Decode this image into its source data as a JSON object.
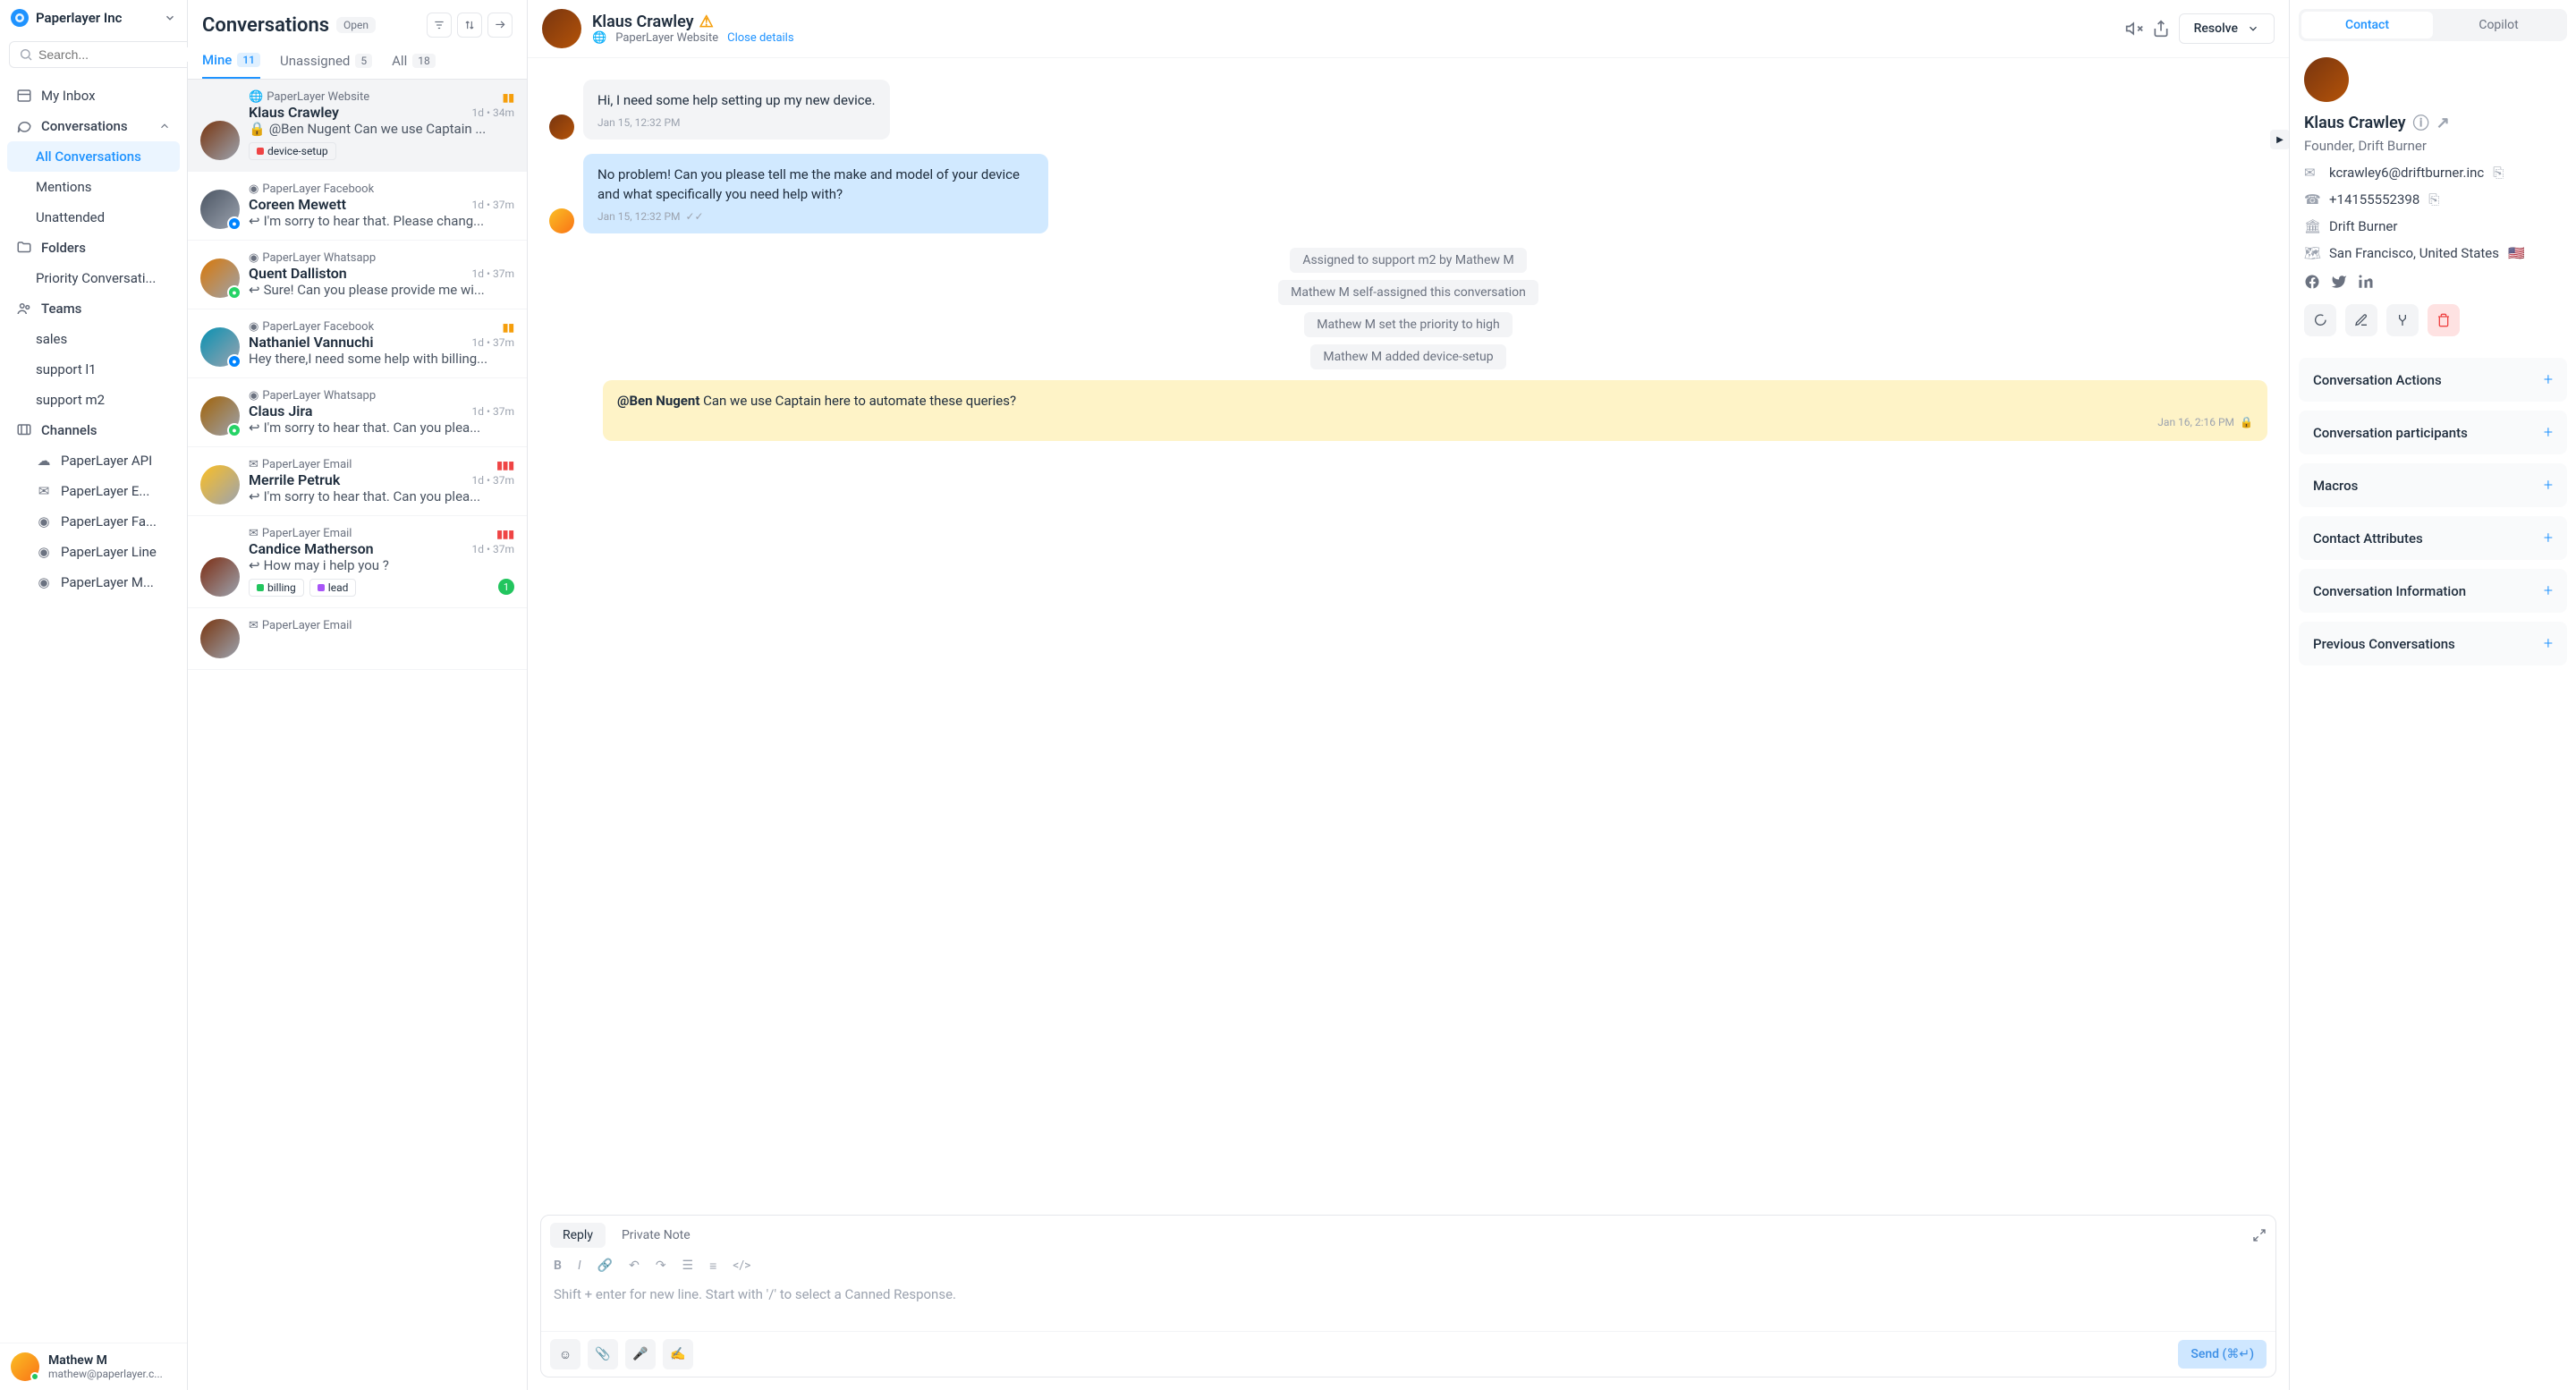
{
  "workspace": {
    "name": "Paperlayer Inc"
  },
  "search": {
    "placeholder": "Search..."
  },
  "nav": {
    "inbox": "My Inbox",
    "conversations": "Conversations",
    "all_conv": "All Conversations",
    "mentions": "Mentions",
    "unattended": "Unattended",
    "folders": "Folders",
    "priority": "Priority Conversati...",
    "teams": "Teams",
    "team1": "sales",
    "team2": "support l1",
    "team3": "support m2",
    "channels": "Channels",
    "ch": [
      "PaperLayer API",
      "PaperLayer E...",
      "PaperLayer Fa...",
      "PaperLayer Line",
      "PaperLayer M..."
    ]
  },
  "user": {
    "name": "Mathew M",
    "email": "mathew@paperlayer.c..."
  },
  "list": {
    "title": "Conversations",
    "status": "Open",
    "tabs": {
      "mine": "Mine",
      "mine_count": "11",
      "unassigned": "Unassigned",
      "un_count": "5",
      "all": "All",
      "all_count": "18"
    },
    "items": [
      {
        "channel": "PaperLayer Website",
        "name": "Klaus Crawley",
        "time": "1d • 34m",
        "preview": "@Ben Nugent Can we use Captain ...",
        "labels": [
          {
            "c": "#ef4444",
            "t": "device-setup"
          }
        ],
        "selected": true,
        "priority": true,
        "lock": true,
        "ch_ico": "globe"
      },
      {
        "channel": "PaperLayer Facebook",
        "name": "Coreen Mewett",
        "time": "1d • 37m",
        "preview": "I'm sorry to hear that. Please chang...",
        "reply": true,
        "ch_badge": "#0084ff"
      },
      {
        "channel": "PaperLayer Whatsapp",
        "name": "Quent Dalliston",
        "time": "1d • 37m",
        "preview": "Sure! Can you please provide me wi...",
        "reply": true,
        "ch_badge": "#25d366"
      },
      {
        "channel": "PaperLayer Facebook",
        "name": "Nathaniel Vannuchi",
        "time": "1d • 37m",
        "preview": "Hey there,I need some help with billing...",
        "priority": true,
        "ch_badge": "#0084ff"
      },
      {
        "channel": "PaperLayer Whatsapp",
        "name": "Claus Jira",
        "time": "1d • 37m",
        "preview": "I'm sorry to hear that. Can you plea...",
        "reply": true,
        "ch_badge": "#25d366"
      },
      {
        "channel": "PaperLayer Email",
        "name": "Merrile Petruk",
        "time": "1d • 37m",
        "preview": "I'm sorry to hear that. Can you plea...",
        "reply": true,
        "priority_red": true
      },
      {
        "channel": "PaperLayer Email",
        "name": "Candice Matherson",
        "time": "1d • 37m",
        "preview": "How may i help you ?",
        "reply": true,
        "unread": "1",
        "priority_red": true,
        "labels": [
          {
            "c": "#22c55e",
            "t": "billing"
          },
          {
            "c": "#a855f7",
            "t": "lead"
          }
        ]
      },
      {
        "channel": "PaperLayer Email",
        "name": "",
        "time": "",
        "preview": ""
      }
    ]
  },
  "chat": {
    "name": "Klaus Crawley",
    "channel": "PaperLayer Website",
    "close": "Close details",
    "resolve": "Resolve",
    "msg1": {
      "text": "Hi, I need some help setting up my new device.",
      "time": "Jan 15, 12:32 PM"
    },
    "msg2": {
      "text": "No problem! Can you please tell me the make and model of your device and what specifically you need help with?",
      "time": "Jan 15, 12:32 PM"
    },
    "sys": [
      "Assigned to support m2 by Mathew M",
      "Mathew M self-assigned this conversation",
      "Mathew M set the priority to high",
      "Mathew M added device-setup"
    ],
    "note": {
      "mention": "@Ben Nugent",
      "rest": " Can we use Captain here to automate these queries?",
      "time": "Jan 16, 2:16 PM"
    },
    "composer": {
      "reply": "Reply",
      "private": "Private Note",
      "placeholder": "Shift + enter for new line. Start with '/' to select a Canned Response.",
      "send": "Send (⌘↵)"
    }
  },
  "details": {
    "tabs": {
      "contact": "Contact",
      "copilot": "Copilot"
    },
    "name": "Klaus Crawley",
    "role": "Founder, Drift Burner",
    "email": "kcrawley6@driftburner.inc",
    "phone": "+14155552398",
    "company": "Drift Burner",
    "location": "San Francisco, United States",
    "flag": "🇺🇸",
    "sections": [
      "Conversation Actions",
      "Conversation participants",
      "Macros",
      "Contact Attributes",
      "Conversation Information",
      "Previous Conversations"
    ]
  }
}
